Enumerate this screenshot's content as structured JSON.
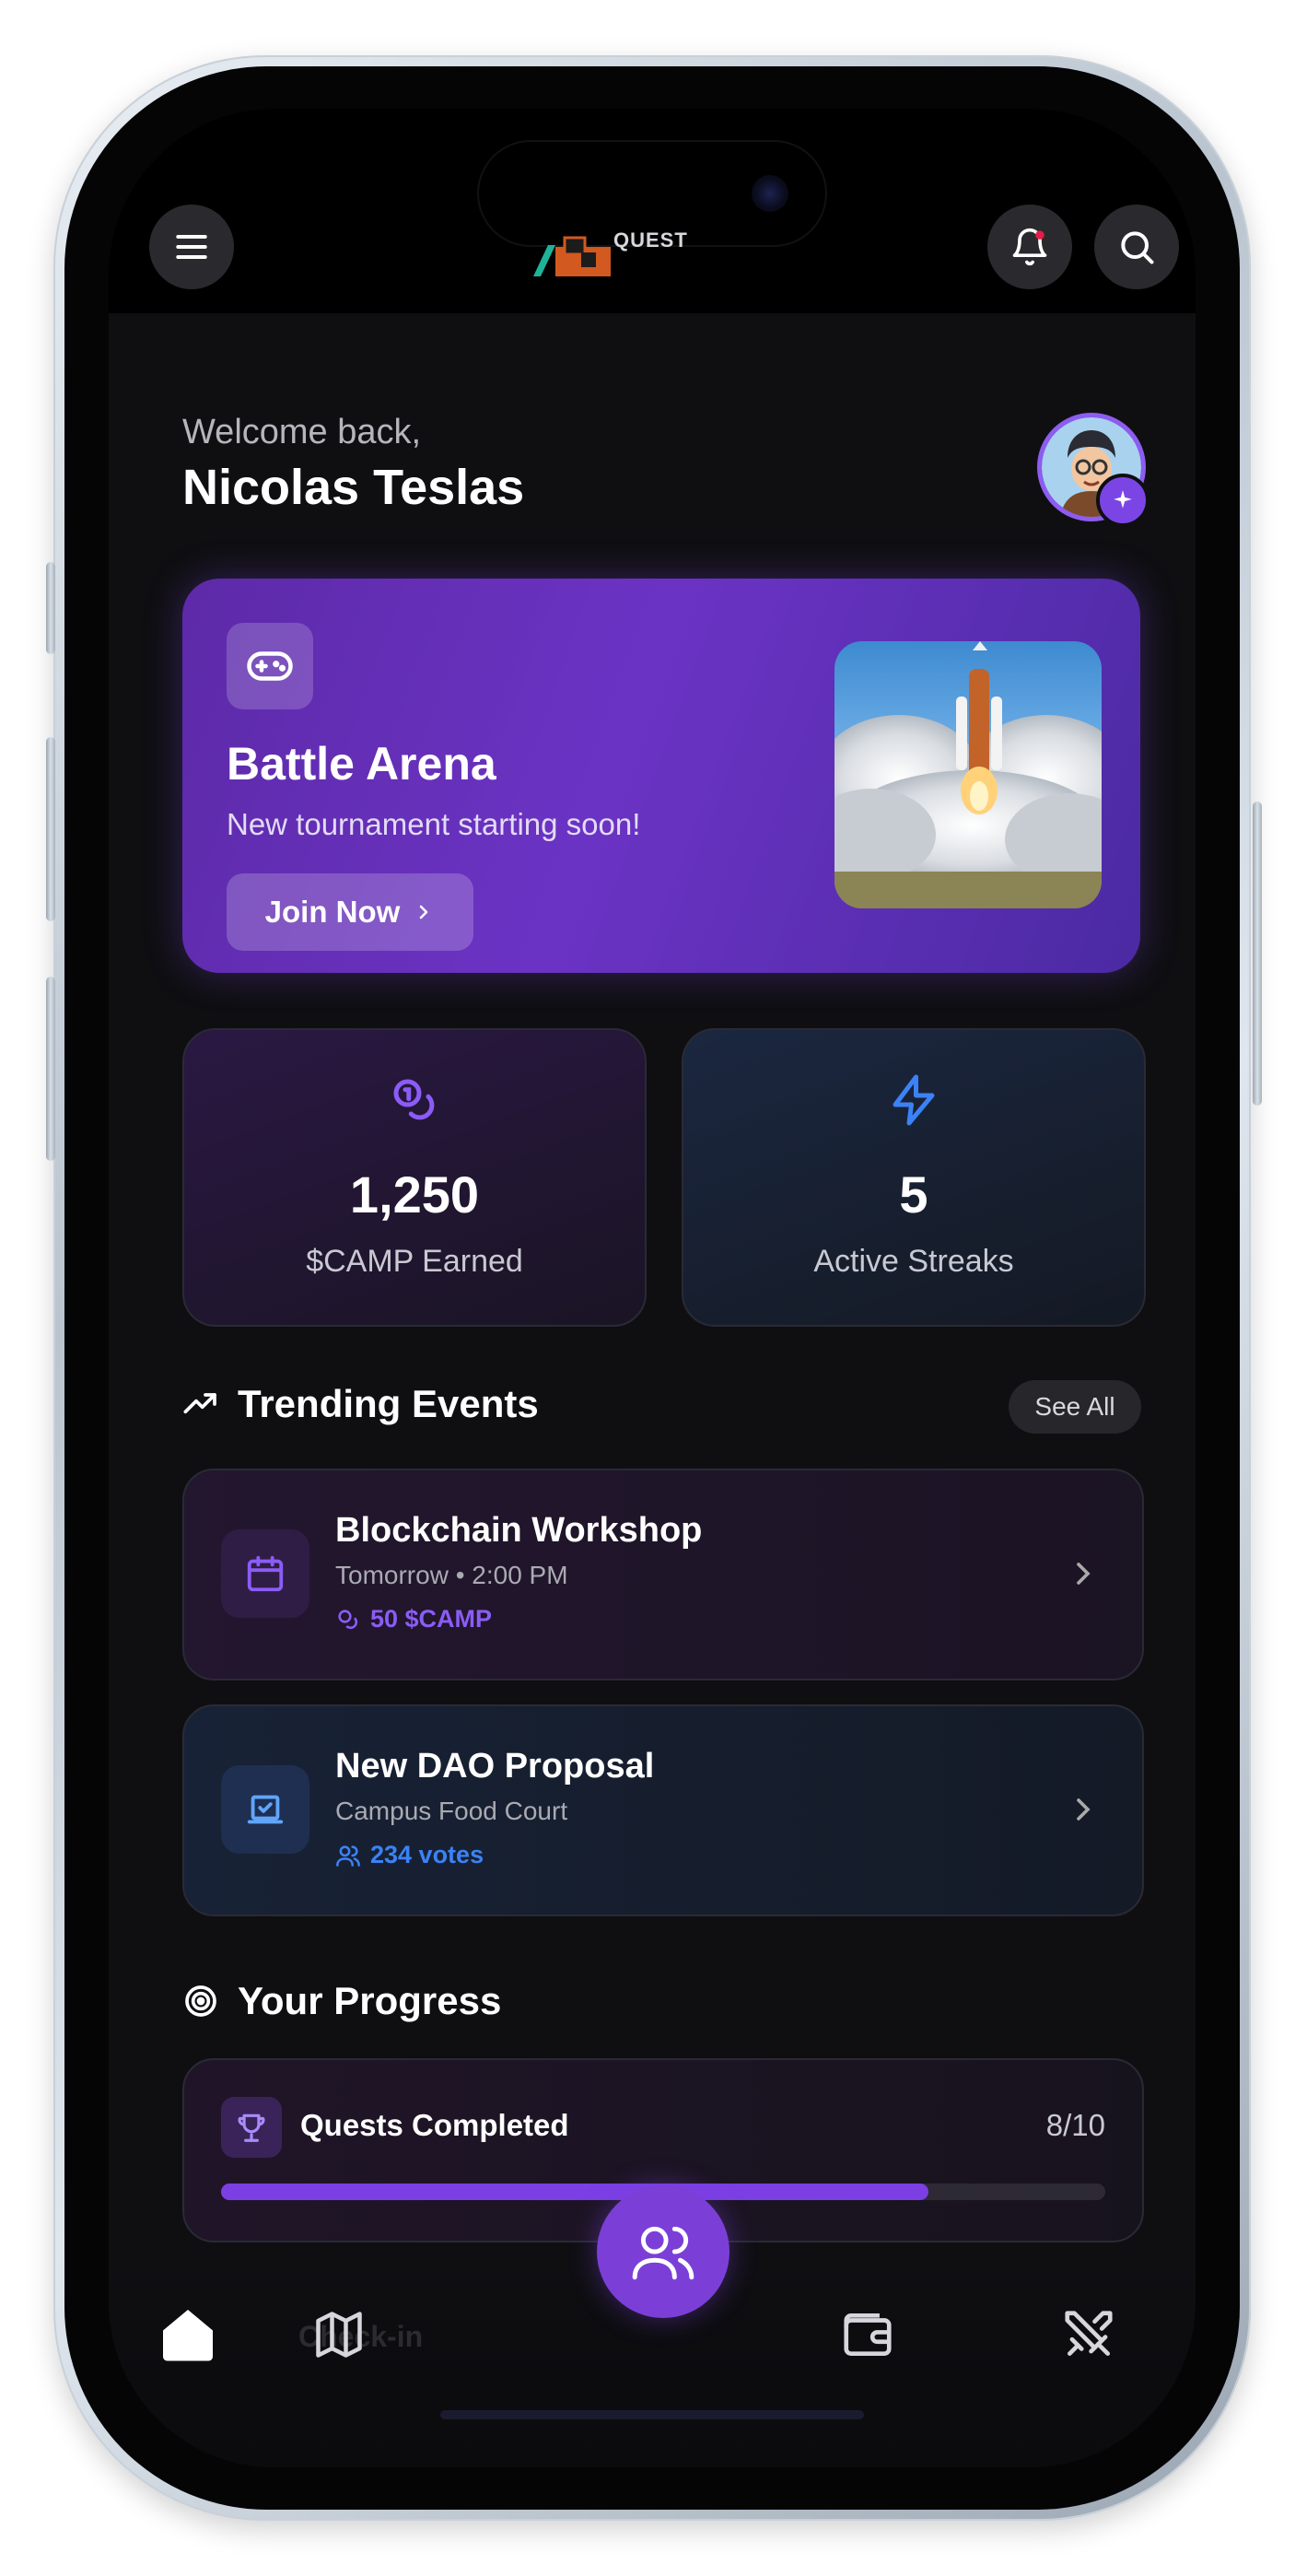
{
  "header": {
    "logo_text": "QUEST",
    "menu_icon": "hamburger-menu-icon",
    "notification_icon": "bell-icon",
    "search_icon": "search-icon"
  },
  "welcome": {
    "greeting": "Welcome back,",
    "user_name": "Nicolas Teslas"
  },
  "hero": {
    "title": "Battle Arena",
    "subtitle": "New tournament starting soon!",
    "button_label": "Join Now",
    "icon": "gamepad-icon"
  },
  "stats": [
    {
      "value": "1,250",
      "label": "$CAMP Earned",
      "icon": "coins-icon",
      "color": "#8b5cf6"
    },
    {
      "value": "5",
      "label": "Active Streaks",
      "icon": "lightning-icon",
      "color": "#3b82f6"
    }
  ],
  "trending": {
    "title": "Trending Events",
    "see_all_label": "See All",
    "events": [
      {
        "title": "Blockchain Workshop",
        "subtitle": "Tomorrow • 2:00 PM",
        "meta": "50 $CAMP",
        "meta_color": "#8b5cf6",
        "icon": "calendar-icon"
      },
      {
        "title": "New DAO Proposal",
        "subtitle": "Campus Food Court",
        "meta": "234 votes",
        "meta_color": "#3b82f6",
        "icon": "vote-icon"
      }
    ]
  },
  "progress": {
    "title": "Your Progress",
    "items": [
      {
        "label": "Quests Completed",
        "count": "8/10",
        "fraction": 0.8
      }
    ],
    "hidden_item_label": "Check-in"
  },
  "bottom_nav": {
    "items": [
      "home-icon",
      "map-icon",
      "community-icon",
      "wallet-icon",
      "battle-icon"
    ]
  },
  "colors": {
    "accent_purple": "#7b3fe4",
    "accent_blue": "#3b82f6",
    "background": "#0f0f12"
  }
}
